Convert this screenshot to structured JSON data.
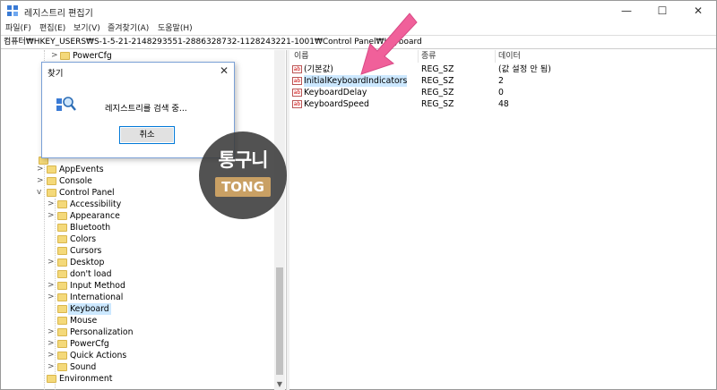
{
  "window": {
    "title": "레지스트리 편집기",
    "icon": "regedit-icon"
  },
  "window_controls": {
    "minimize": "—",
    "maximize": "☐",
    "close": "✕"
  },
  "menu": [
    "파일(F)",
    "편집(E)",
    "보기(V)",
    "즐겨찾기(A)",
    "도움말(H)"
  ],
  "address": "컴퓨터₩HKEY_USERS₩S-1-5-21-2148293551-2886328732-1128243221-1001₩Control Panel₩Keyboard",
  "tree": {
    "top_items": [
      {
        "label": "PowerCfg",
        "chevron": ">"
      }
    ],
    "root_items": [
      {
        "label": "AppEvents",
        "chevron": ">"
      },
      {
        "label": "Console",
        "chevron": ">"
      },
      {
        "label": "Control Panel",
        "chevron": "v"
      }
    ],
    "control_panel_children": [
      {
        "label": "Accessibility",
        "chevron": ">"
      },
      {
        "label": "Appearance",
        "chevron": ">"
      },
      {
        "label": "Bluetooth",
        "chevron": ""
      },
      {
        "label": "Colors",
        "chevron": ""
      },
      {
        "label": "Cursors",
        "chevron": ""
      },
      {
        "label": "Desktop",
        "chevron": ">"
      },
      {
        "label": "don't load",
        "chevron": ""
      },
      {
        "label": "Input Method",
        "chevron": ">"
      },
      {
        "label": "International",
        "chevron": ">"
      },
      {
        "label": "Keyboard",
        "chevron": "",
        "selected": true
      },
      {
        "label": "Mouse",
        "chevron": ""
      },
      {
        "label": "Personalization",
        "chevron": ">"
      },
      {
        "label": "PowerCfg",
        "chevron": ">"
      },
      {
        "label": "Quick Actions",
        "chevron": ">"
      },
      {
        "label": "Sound",
        "chevron": ">"
      }
    ],
    "partial_item": "Environment"
  },
  "list": {
    "columns": [
      "이름",
      "종류",
      "데이터"
    ],
    "rows": [
      {
        "name": "(기본값)",
        "type": "REG_SZ",
        "data": "(값 설정 안 됨)"
      },
      {
        "name": "InitialKeyboardIndicators",
        "type": "REG_SZ",
        "data": "2"
      },
      {
        "name": "KeyboardDelay",
        "type": "REG_SZ",
        "data": "0"
      },
      {
        "name": "KeyboardSpeed",
        "type": "REG_SZ",
        "data": "48"
      }
    ]
  },
  "dialog": {
    "title": "찾기",
    "close": "✕",
    "message": "레지스트리를 검색 중...",
    "cancel_label": "취소",
    "icon": "search-registry-icon"
  },
  "watermark": {
    "line1": "통구니",
    "badge": "TONG"
  },
  "colors": {
    "accent": "#0078d7",
    "selection": "#cce8ff",
    "arrow": "#f0609a",
    "folder": "#f4d97a"
  }
}
